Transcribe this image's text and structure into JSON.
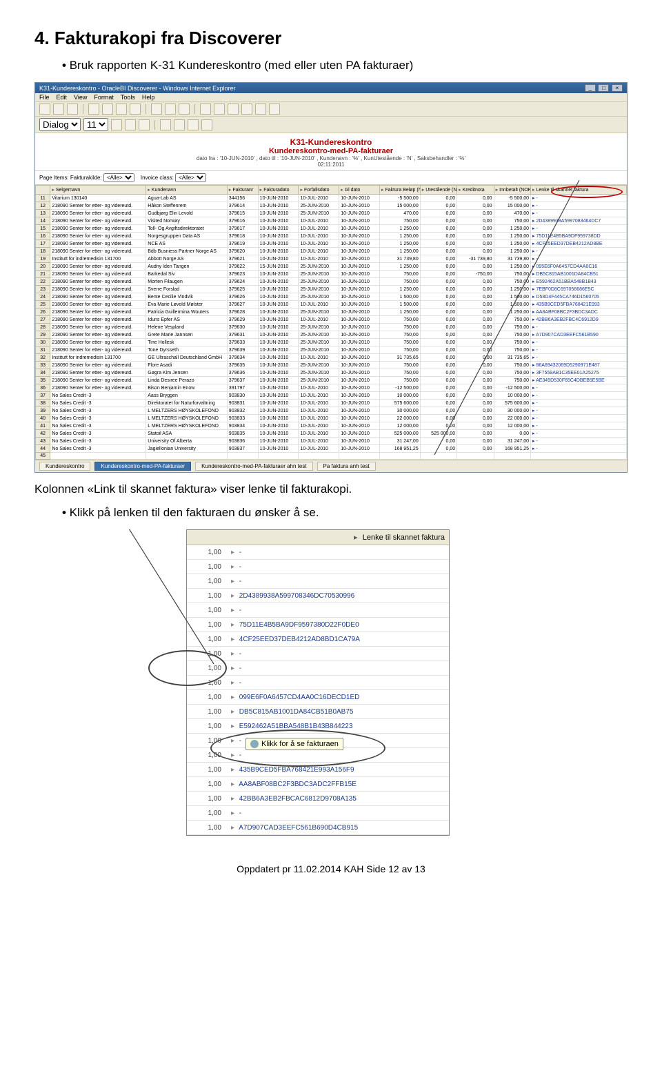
{
  "doc": {
    "section_title": "4. Fakturakopi fra Discoverer",
    "bullet1": "Bruk rapporten K-31 Kundereskontro (med eller uten PA fakturaer)",
    "para_after": "Kolonnen «Link til skannet faktura» viser lenke til fakturakopi.",
    "bullet2": "Klikk på lenken til den fakturaen du ønsker å se.",
    "footer": "Oppdatert pr 11.02.2014 KAH          Side 12 av 13"
  },
  "window": {
    "title": "K31-Kundereskontro - OracleBI Discoverer - Windows Internet Explorer",
    "menus": [
      "File",
      "Edit",
      "View",
      "Format",
      "Tools",
      "Help"
    ],
    "report_title": "K31-Kundereskontro",
    "report_sub": "Kundereskontro-med-PA-fakturaer",
    "report_meta1": "dato fra : '10-JUN-2010' , dato til : '10-JUN-2010' , Kundenavn : '%' , KunUtestående : 'N' , Saksbehandler : '%'",
    "report_meta2": "02:11:2011",
    "page_items_label": "Page Items:",
    "pi1_label": "Fakturakilde:",
    "pi1_value": "<Alle>",
    "pi2_label": "Invoice class:",
    "pi2_value": "<Alle>"
  },
  "grid": {
    "columns": [
      "",
      "Selgernavn",
      "Kundenavn",
      "Fakturanr",
      "Fakturadato",
      "Forfallsdato",
      "Gl dato",
      "Faktura Beløp (NOK)",
      "Utestående (NOK)",
      "Kreditnota",
      "Innbetalt (NOK)",
      "Lenke til skannet faktura"
    ],
    "rows": [
      {
        "n": 11,
        "selger": "Vitarium 130140",
        "kunde": "Agua-Lab AS",
        "fnr": "344156",
        "fd": "10-JUN-2010",
        "ff": "10-JUL-2010",
        "gl": "10-JUN-2010",
        "belop": "-5 500,00",
        "ute": "0,00",
        "kred": "0,00",
        "inb": "-5 500,00",
        "ln": "▸ -"
      },
      {
        "n": 12,
        "selger": "218090 Senter for etter- og videreutd.",
        "kunde": "Håkon Steffenrem",
        "fnr": "379614",
        "fd": "10-JUN-2010",
        "ff": "25-JUN-2010",
        "gl": "10-JUN-2010",
        "belop": "15 000,00",
        "ute": "0,00",
        "kred": "0,00",
        "inb": "15 000,00",
        "ln": "▸ -"
      },
      {
        "n": 13,
        "selger": "218090 Senter for etter- og videreutd.",
        "kunde": "Gudbjørg Elin Levold",
        "fnr": "379615",
        "fd": "10-JUN-2010",
        "ff": "25-JUN-2010",
        "gl": "10-JUN-2010",
        "belop": "470,00",
        "ute": "0,00",
        "kred": "0,00",
        "inb": "470,00",
        "ln": "▸ -"
      },
      {
        "n": 14,
        "selger": "218090 Senter for etter- og videreutd.",
        "kunde": "Visited Norway",
        "fnr": "379616",
        "fd": "10-JUN-2010",
        "ff": "10-JUL-2010",
        "gl": "10-JUN-2010",
        "belop": "750,00",
        "ute": "0,00",
        "kred": "0,00",
        "inb": "750,00",
        "ln": "▸ 2D4389938A5997083464DC7"
      },
      {
        "n": 15,
        "selger": "218090 Senter for etter- og videreutd.",
        "kunde": "Toll- Og Avgiftsdirektoratet",
        "fnr": "379617",
        "fd": "10-JUN-2010",
        "ff": "10-JUL-2010",
        "gl": "10-JUN-2010",
        "belop": "1 250,00",
        "ute": "0,00",
        "kred": "0,00",
        "inb": "1 250,00",
        "ln": "▸ -"
      },
      {
        "n": 16,
        "selger": "218090 Senter for etter- og videreutd.",
        "kunde": "Norgesgruppen Data AS",
        "fnr": "379618",
        "fd": "10-JUN-2010",
        "ff": "10-JUL-2010",
        "gl": "10-JUN-2010",
        "belop": "1 250,00",
        "ute": "0,00",
        "kred": "0,00",
        "inb": "1 250,00",
        "ln": "▸ 75D11E4B5BA9DF959738DD"
      },
      {
        "n": 17,
        "selger": "218090 Senter for etter- og videreutd.",
        "kunde": "NCE AS",
        "fnr": "379619",
        "fd": "10-JUN-2010",
        "ff": "10-JUL-2010",
        "gl": "10-JUN-2010",
        "belop": "1 250,00",
        "ute": "0,00",
        "kred": "0,00",
        "inb": "1 250,00",
        "ln": "▸ 4CF25EED37DEB4212AD8BE"
      },
      {
        "n": 18,
        "selger": "218090 Senter for etter- og videreutd.",
        "kunde": "Bdb Busniess Partner Norge AS",
        "fnr": "379620",
        "fd": "10-JUN-2010",
        "ff": "10-JUL-2010",
        "gl": "10-JUN-2010",
        "belop": "1 250,00",
        "ute": "0,00",
        "kred": "0,00",
        "inb": "1 250,00",
        "ln": "▸ -"
      },
      {
        "n": 19,
        "selger": "Institutt for indremedisin 131700",
        "kunde": "Abbott Norge AS",
        "fnr": "379621",
        "fd": "10-JUN-2010",
        "ff": "10-JUL-2010",
        "gl": "10-JUN-2010",
        "belop": "31 739,80",
        "ute": "0,00",
        "kred": "-31 739,80",
        "inb": "31 739,80",
        "ln": "▸ -"
      },
      {
        "n": 20,
        "selger": "218090 Senter for etter- og videreutd.",
        "kunde": "Audny Iden Tangen",
        "fnr": "379622",
        "fd": "15-JUN-2010",
        "ff": "25-JUN-2010",
        "gl": "10-JUN-2010",
        "belop": "1 250,00",
        "ute": "0,00",
        "kred": "0,00",
        "inb": "1 250,00",
        "ln": "▸ 095E6F0A6457CD4AA0C16"
      },
      {
        "n": 21,
        "selger": "218090 Senter for etter- og videreutd.",
        "kunde": "Barkedal Siv",
        "fnr": "379623",
        "fd": "10-JUN-2010",
        "ff": "25-JUN-2010",
        "gl": "10-JUN-2010",
        "belop": "750,00",
        "ute": "0,00",
        "kred": "-750,00",
        "inb": "750,00",
        "ln": "▸ DB5C815AB1001DA84CB51"
      },
      {
        "n": 22,
        "selger": "218090 Senter for etter- og videreutd.",
        "kunde": "Morten Filaugen",
        "fnr": "379624",
        "fd": "10-JUN-2010",
        "ff": "25-JUN-2010",
        "gl": "10-JUN-2010",
        "belop": "750,00",
        "ute": "0,00",
        "kred": "0,00",
        "inb": "750,00",
        "ln": "▸ E592462A51BBA548B1B43"
      },
      {
        "n": 23,
        "selger": "218090 Senter for etter- og videreutd.",
        "kunde": "Sverre Forslad",
        "fnr": "379625",
        "fd": "10-JUN-2010",
        "ff": "25-JUN-2010",
        "gl": "10-JUN-2010",
        "belop": "1 250,00",
        "ute": "0,00",
        "kred": "0,00",
        "inb": "1 250,00",
        "ln": "▸ 7EBF0D8C697056686E5C"
      },
      {
        "n": 24,
        "selger": "218090 Senter for etter- og videreutd.",
        "kunde": "Bente Cecilie Vindvik",
        "fnr": "379626",
        "fd": "10-JUN-2010",
        "ff": "25-JUN-2010",
        "gl": "10-JUN-2010",
        "belop": "1 500,00",
        "ute": "0,00",
        "kred": "0,00",
        "inb": "1 500,00",
        "ln": "▸ D58D4F445CA746D1560705"
      },
      {
        "n": 25,
        "selger": "218090 Senter for etter- og videreutd.",
        "kunde": "Eva Marie Løvold Mølster",
        "fnr": "379627",
        "fd": "10-JUN-2010",
        "ff": "10-JUL-2010",
        "gl": "10-JUN-2010",
        "belop": "1 500,00",
        "ute": "0,00",
        "kred": "0,00",
        "inb": "1 500,00",
        "ln": "▸ 435B9CED5FBA768421E993"
      },
      {
        "n": 26,
        "selger": "218090 Senter for etter- og videreutd.",
        "kunde": "Patricia Guillermina Wouters",
        "fnr": "379628",
        "fd": "10-JUN-2010",
        "ff": "25-JUN-2010",
        "gl": "10-JUN-2010",
        "belop": "1 250,00",
        "ute": "0,00",
        "kred": "0,00",
        "inb": "1 250,00",
        "ln": "▸ AA8ABF08BC2F3BDC3ADC"
      },
      {
        "n": 27,
        "selger": "218090 Senter for etter- og videreutd.",
        "kunde": "Iduns Epfer AS",
        "fnr": "379629",
        "fd": "10-JUN-2010",
        "ff": "10-JUL-2010",
        "gl": "10-JUN-2010",
        "belop": "750,00",
        "ute": "0,00",
        "kred": "0,00",
        "inb": "750,00",
        "ln": "▸ 42BB6A3EB2FBC4C6912D9"
      },
      {
        "n": 28,
        "selger": "218090 Senter for etter- og videreutd.",
        "kunde": "Helene Vespland",
        "fnr": "379630",
        "fd": "10-JUN-2010",
        "ff": "25-JUN-2010",
        "gl": "10-JUN-2010",
        "belop": "750,00",
        "ute": "0,00",
        "kred": "0,00",
        "inb": "750,00",
        "ln": "▸ -"
      },
      {
        "n": 29,
        "selger": "218090 Senter for etter- og videreutd.",
        "kunde": "Grete Marie Jannsen",
        "fnr": "379631",
        "fd": "10-JUN-2010",
        "ff": "25-JUN-2010",
        "gl": "10-JUN-2010",
        "belop": "750,00",
        "ute": "0,00",
        "kred": "0,00",
        "inb": "750,00",
        "ln": "▸ A7D907CAD3EEFC561B590"
      },
      {
        "n": 30,
        "selger": "218090 Senter for etter- og videreutd.",
        "kunde": "Tine Hollesk",
        "fnr": "379633",
        "fd": "10-JUN-2010",
        "ff": "25-JUN-2010",
        "gl": "10-JUN-2010",
        "belop": "750,00",
        "ute": "0,00",
        "kred": "0,00",
        "inb": "750,00",
        "ln": "▸ -"
      },
      {
        "n": 31,
        "selger": "218090 Senter for etter- og videreutd.",
        "kunde": "Tone Dyrsseth",
        "fnr": "379639",
        "fd": "10-JUN-2010",
        "ff": "25-JUN-2010",
        "gl": "10-JUN-2010",
        "belop": "750,00",
        "ute": "0,00",
        "kred": "0,00",
        "inb": "750,00",
        "ln": "▸ -"
      },
      {
        "n": 32,
        "selger": "Institutt for indremedisin 131700",
        "kunde": "GE Ultraschall Deutschland GmbH",
        "fnr": "379634",
        "fd": "10-JUN-2010",
        "ff": "10-JUL-2010",
        "gl": "10-JUN-2010",
        "belop": "31 735,65",
        "ute": "0,00",
        "kred": "0,00",
        "inb": "31 735,65",
        "ln": "▸ -"
      },
      {
        "n": 33,
        "selger": "218090 Senter for etter- og videreutd.",
        "kunde": "Flore Asadi",
        "fnr": "379635",
        "fd": "10-JUN-2010",
        "ff": "25-JUN-2010",
        "gl": "10-JUN-2010",
        "belop": "750,00",
        "ute": "0,00",
        "kred": "0,00",
        "inb": "750,00",
        "ln": "▸ 86A69432069D5290971E487"
      },
      {
        "n": 34,
        "selger": "218090 Senter for etter- og videreutd.",
        "kunde": "Gøgra Kim Jensen",
        "fnr": "379636",
        "fd": "10-JUN-2010",
        "ff": "25-JUN-2010",
        "gl": "10-JUN-2010",
        "belop": "750,00",
        "ute": "0,00",
        "kred": "0,00",
        "inb": "750,00",
        "ln": "▸ 3F7559AB1C35EE01A25275"
      },
      {
        "n": 35,
        "selger": "218090 Senter for etter- og videreutd.",
        "kunde": "Linda Desiree Perazo",
        "fnr": "379637",
        "fd": "10-JUN-2010",
        "ff": "25-JUN-2010",
        "gl": "10-JUN-2010",
        "belop": "750,00",
        "ute": "0,00",
        "kred": "0,00",
        "inb": "750,00",
        "ln": "▸ AE349D530F65C4DBEB5E5BE"
      },
      {
        "n": 36,
        "selger": "218090 Senter for etter- og videreutd.",
        "kunde": "Bison Benjamin Enow",
        "fnr": "391797",
        "fd": "10-JUN-2010",
        "ff": "10-JUL-2010",
        "gl": "10-JUN-2010",
        "belop": "-12 500,00",
        "ute": "0,00",
        "kred": "0,00",
        "inb": "-12 500,00",
        "ln": "▸ -"
      },
      {
        "n": 37,
        "selger": "No Sales Credit -3",
        "kunde": "Aass Bryggen",
        "fnr": "903830",
        "fd": "10-JUN-2010",
        "ff": "10-JUL-2010",
        "gl": "10-JUN-2010",
        "belop": "10 000,00",
        "ute": "0,00",
        "kred": "0,00",
        "inb": "10 000,00",
        "ln": "▸ -"
      },
      {
        "n": 38,
        "selger": "No Sales Credit -3",
        "kunde": "Direktoratet for Naturforvaltning",
        "fnr": "903831",
        "fd": "10-JUN-2010",
        "ff": "10-JUL-2010",
        "gl": "10-JUN-2010",
        "belop": "575 600,00",
        "ute": "0,00",
        "kred": "0,00",
        "inb": "575 600,00",
        "ln": "▸ -"
      },
      {
        "n": 39,
        "selger": "No Sales Credit -3",
        "kunde": "L MELTZERS HØYSKOLEFOND",
        "fnr": "903832",
        "fd": "10-JUN-2010",
        "ff": "10-JUL-2010",
        "gl": "10-JUN-2010",
        "belop": "30 000,00",
        "ute": "0,00",
        "kred": "0,00",
        "inb": "30 000,00",
        "ln": "▸ -"
      },
      {
        "n": 40,
        "selger": "No Sales Credit -3",
        "kunde": "L MELTZERS HØYSKOLEFOND",
        "fnr": "903833",
        "fd": "10-JUN-2010",
        "ff": "10-JUL-2010",
        "gl": "10-JUN-2010",
        "belop": "22 000,00",
        "ute": "0,00",
        "kred": "0,00",
        "inb": "22 000,00",
        "ln": "▸ -"
      },
      {
        "n": 41,
        "selger": "No Sales Credit -3",
        "kunde": "L MELTZERS HØYSKOLEFOND",
        "fnr": "903834",
        "fd": "10-JUN-2010",
        "ff": "10-JUL-2010",
        "gl": "10-JUN-2010",
        "belop": "12 000,00",
        "ute": "0,00",
        "kred": "0,00",
        "inb": "12 000,00",
        "ln": "▸ -"
      },
      {
        "n": 42,
        "selger": "No Sales Credit -3",
        "kunde": "Statoil ASA",
        "fnr": "903835",
        "fd": "10-JUN-2010",
        "ff": "10-JUL-2010",
        "gl": "10-JUN-2010",
        "belop": "525 000,00",
        "ute": "525 000,00",
        "kred": "0,00",
        "inb": "0,00",
        "ln": "▸ -"
      },
      {
        "n": 43,
        "selger": "No Sales Credit -3",
        "kunde": "University Of Alberta",
        "fnr": "903836",
        "fd": "10-JUN-2010",
        "ff": "10-JUL-2010",
        "gl": "10-JUN-2010",
        "belop": "31 247,00",
        "ute": "0,00",
        "kred": "0,00",
        "inb": "31 247,00",
        "ln": "▸ -"
      },
      {
        "n": 44,
        "selger": "No Sales Credit -3",
        "kunde": "Jagiellonian University",
        "fnr": "903837",
        "fd": "10-JUN-2010",
        "ff": "10-JUL-2010",
        "gl": "10-JUN-2010",
        "belop": "168 951,25",
        "ute": "0,00",
        "kred": "0,00",
        "inb": "168 951,25",
        "ln": "▸ -"
      },
      {
        "n": 45,
        "selger": "",
        "kunde": "",
        "fnr": "",
        "fd": "",
        "ff": "",
        "gl": "",
        "belop": "",
        "ute": "",
        "kred": "",
        "inb": "",
        "ln": ""
      }
    ]
  },
  "tabs": {
    "t1": "Kundereskontro",
    "t2": "Kundereskontro-med-PA-fakturaer",
    "t3": "Kundereskontro-med-PA-fakturaer ahn test",
    "t4": "Pa faktura anh test"
  },
  "links_img": {
    "header": "Lenke til skannet faktura",
    "tooltip": "Klikk for å se fakturaen",
    "rows": [
      {
        "v": "1,00",
        "l": "-"
      },
      {
        "v": "1,00",
        "l": "-"
      },
      {
        "v": "1,00",
        "l": "-"
      },
      {
        "v": "1,00",
        "l": "2D4389938A599708346DC70530996"
      },
      {
        "v": "1,00",
        "l": "-"
      },
      {
        "v": "1,00",
        "l": "75D11E4B5BA9DF9597380D22F0DE0"
      },
      {
        "v": "1,00",
        "l": "4CF25EED37DEB4212AD8BD1CA79A"
      },
      {
        "v": "1,00",
        "l": "-"
      },
      {
        "v": "1,00",
        "l": "-"
      },
      {
        "v": "1,60",
        "l": "-"
      },
      {
        "v": "1,00",
        "l": "099E6F0A6457CD4AA0C16DECD1ED"
      },
      {
        "v": "1,00",
        "l": "DB5C815AB1001DA84CB51B0AB75"
      },
      {
        "v": "1,00",
        "l": "E592462A51BBA548B1B43B844223"
      },
      {
        "v": "1,00",
        "l": "-"
      },
      {
        "v": "1,00",
        "l": "-"
      },
      {
        "v": "1,00",
        "l": "435B9CED5FBA768421E993A156F9"
      },
      {
        "v": "1,00",
        "l": "AA8ABF08BC2F3BDC3ADC2FFB15E"
      },
      {
        "v": "1,00",
        "l": "42BB6A3EB2FBCAC6812D9708A135"
      },
      {
        "v": "1,00",
        "l": "-"
      },
      {
        "v": "1,00",
        "l": "A7D907CAD3EEFC561B690D4CB915"
      }
    ]
  }
}
